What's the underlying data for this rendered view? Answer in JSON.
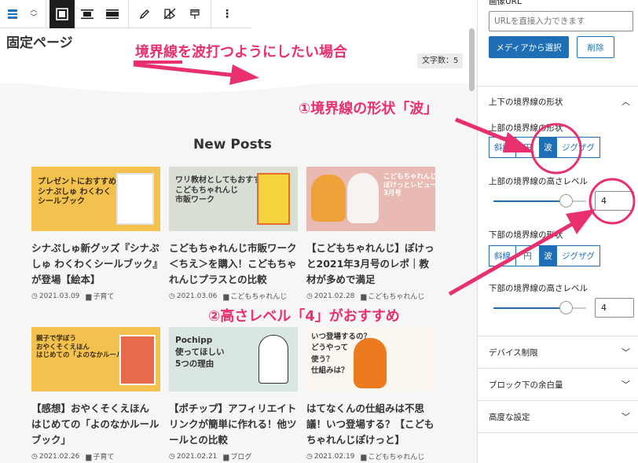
{
  "editor": {
    "page_title": "固定ページ",
    "char_count": "文字数：5",
    "section_title": "New Posts"
  },
  "posts": [
    {
      "title": "シナぷしゅ新グッズ『シナぷしゅ わくわくシールブック』が登場【絵本】",
      "date": "2021.03.09",
      "category": "子育て",
      "thumb": {
        "bg": "#f3c24e",
        "text": "プレゼントにおすすめ\nシナぷしゅ わくわく\nシールブック"
      }
    },
    {
      "title": "こどもちゃれんじ市販ワーク＜ちえ＞を購入！こどもちゃれんじプラスとの比較",
      "date": "2021.03.06",
      "category": "こどもちゃれんじ",
      "thumb": {
        "bg": "#d9dfd4",
        "text": "ワリ教材としてもおすすめ\nこどもちゃれんじ\n市販ワーク"
      }
    },
    {
      "title": "【こどもちゃれんじ】ぽけっと2021年3月号のレポ｜教材が多めで満足",
      "date": "2021.02.28",
      "category": "こどもちゃれんじ",
      "thumb": {
        "bg": "#e9b9b3",
        "text": "こどもちゃれんじ\nぽけっとレビュー\n3月号"
      }
    },
    {
      "title": "【感想】おやくそくえほん はじめての「よのなかルールブック」",
      "date": "2021.02.26",
      "category": "子育て",
      "thumb": {
        "bg": "#f3c24e",
        "text": "親子で学ぼう\nおやくそくえほん\nはじめての「よのなかルールブック」"
      }
    },
    {
      "title": "【ポチップ】アフィリエイトリンクが簡単に作れる！他ツールとの比較",
      "date": "2021.02.21",
      "category": "ブログ",
      "thumb": {
        "bg": "#d9e6df",
        "text": "Pochipp\n使ってほしい\n5つの理由"
      }
    },
    {
      "title": "はてなくんの仕組みは不思議！いつ登場する？【こどもちゃれんじぽけっと】",
      "date": "2021.02.19",
      "category": "こどもちゃれんじ",
      "thumb": {
        "bg": "#fbf6f0",
        "text": "いつ登場するの？\nどうやって\n使う？\n仕組みは？"
      }
    }
  ],
  "annotations": {
    "a1": "境界線を波打つようにしたい場合",
    "a2": "①境界線の形状「波」",
    "a3": "②高さレベル「4」がおすすめ"
  },
  "sidebar": {
    "image_url_label": "画像URL",
    "url_placeholder": "URLを直接入力できます",
    "media_button": "メディアから選択",
    "delete_button": "削除",
    "border_panel_title": "上下の境界線の形状",
    "top_shape_label": "上部の境界線の形状",
    "bottom_shape_label": "下部の境界線の形状",
    "shape_options": [
      "斜線",
      "円",
      "波",
      "ジグザグ"
    ],
    "top_shape_selected": "波",
    "bottom_shape_selected": "波",
    "top_height_label": "上部の境界線の高さレベル",
    "bottom_height_label": "下部の境界線の高さレベル",
    "top_height_value": "4",
    "bottom_height_value": "4",
    "top_slider_fraction": 0.78,
    "bottom_slider_fraction": 0.78,
    "panels": [
      "デバイス制限",
      "ブロック下の余白量",
      "高度な設定"
    ]
  },
  "colors": {
    "accent": "#1e6fb5",
    "annotation": "#e8306f"
  }
}
